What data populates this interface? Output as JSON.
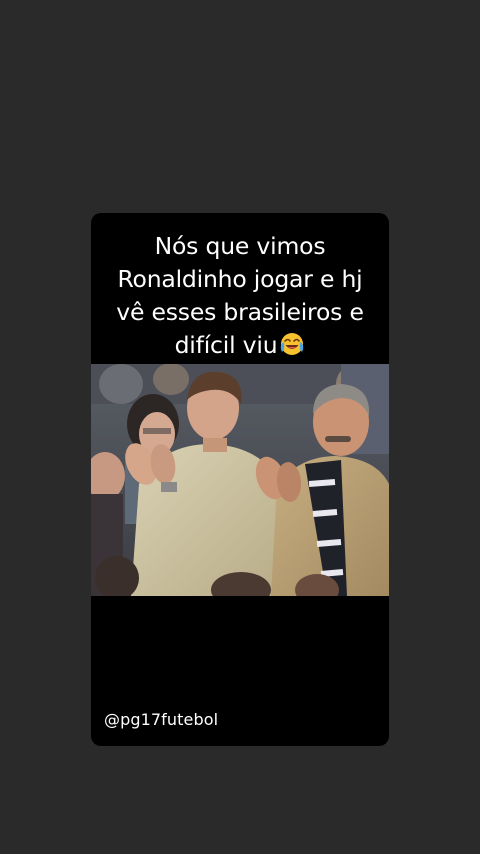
{
  "post": {
    "caption_lines": [
      "Nós que vimos",
      "Ronaldinho jogar e hj",
      "vê esses brasileiros e",
      "difícil  viu"
    ],
    "caption_emoji": "face-with-tears-of-joy-icon",
    "handle": "@pg17futebol"
  },
  "colors": {
    "background": "#2a2a2a",
    "card": "#000000",
    "text": "#ffffff"
  }
}
